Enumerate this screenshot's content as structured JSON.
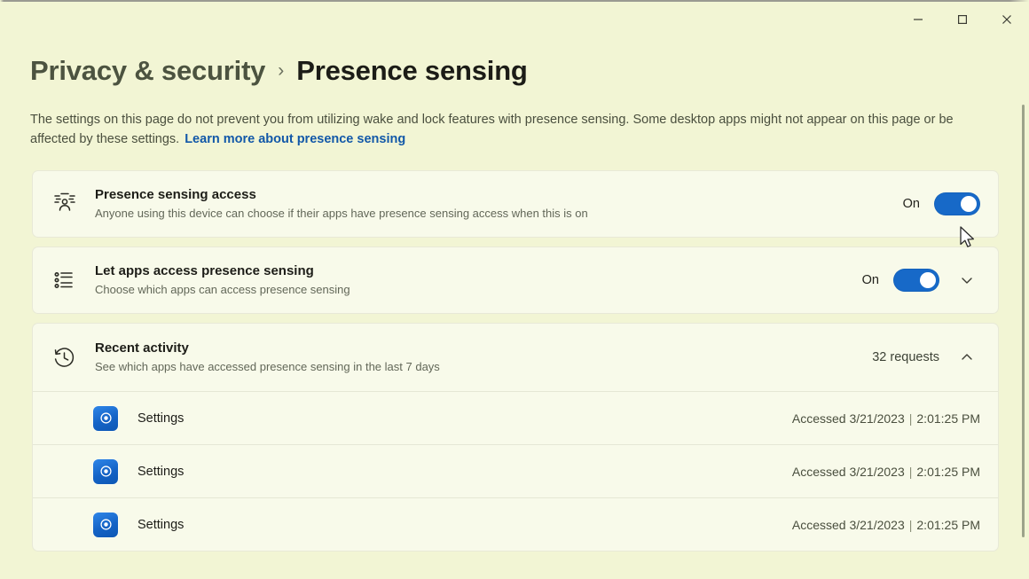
{
  "window": {
    "controls": [
      {
        "name": "minimize",
        "glyph": "minimize-icon",
        "label": "Minimize"
      },
      {
        "name": "maximize",
        "glyph": "maximize-icon",
        "label": "Maximize"
      },
      {
        "name": "close",
        "glyph": "close-icon",
        "label": "Close"
      }
    ]
  },
  "breadcrumb": {
    "parent": "Privacy & security",
    "separator": "›",
    "current": "Presence sensing"
  },
  "description": {
    "text": "The settings on this page do not prevent you from utilizing wake and lock features with presence sensing. Some desktop apps might not appear on this page or be affected by these settings.",
    "link": "Learn more about presence sensing"
  },
  "settings": [
    {
      "icon": "presence-sensing-icon",
      "title": "Presence sensing access",
      "subtitle": "Anyone using this device can choose if their apps have presence sensing access when this is on",
      "toggle_label": "On",
      "toggle_state": "on"
    },
    {
      "icon": "app-list-icon",
      "title": "Let apps access presence sensing",
      "subtitle": "Choose which apps can access presence sensing",
      "toggle_label": "On",
      "toggle_state": "on",
      "expander": "chevron-down-icon"
    }
  ],
  "activity": {
    "icon": "recent-activity-icon",
    "title": "Recent activity",
    "subtitle": "See which apps have accessed presence sensing in the last 7 days",
    "requests_label": "32 requests",
    "expander": "chevron-up-icon",
    "rows": [
      {
        "app": "Settings",
        "icon": "settings-app-icon",
        "accessed_prefix": "Accessed",
        "date": "3/21/2023",
        "separator": "|",
        "time": "2:01:25 PM"
      },
      {
        "app": "Settings",
        "icon": "settings-app-icon",
        "accessed_prefix": "Accessed",
        "date": "3/21/2023",
        "separator": "|",
        "time": "2:01:25 PM"
      },
      {
        "app": "Settings",
        "icon": "settings-app-icon",
        "accessed_prefix": "Accessed",
        "date": "3/21/2023",
        "separator": "|",
        "time": "2:01:25 PM"
      }
    ]
  },
  "colors": {
    "page_background": "#f2f5d4",
    "card_background": "#f8faea",
    "accent_toggle": "#1769c8",
    "link": "#1258a8",
    "app_icon": "#1463c6"
  }
}
